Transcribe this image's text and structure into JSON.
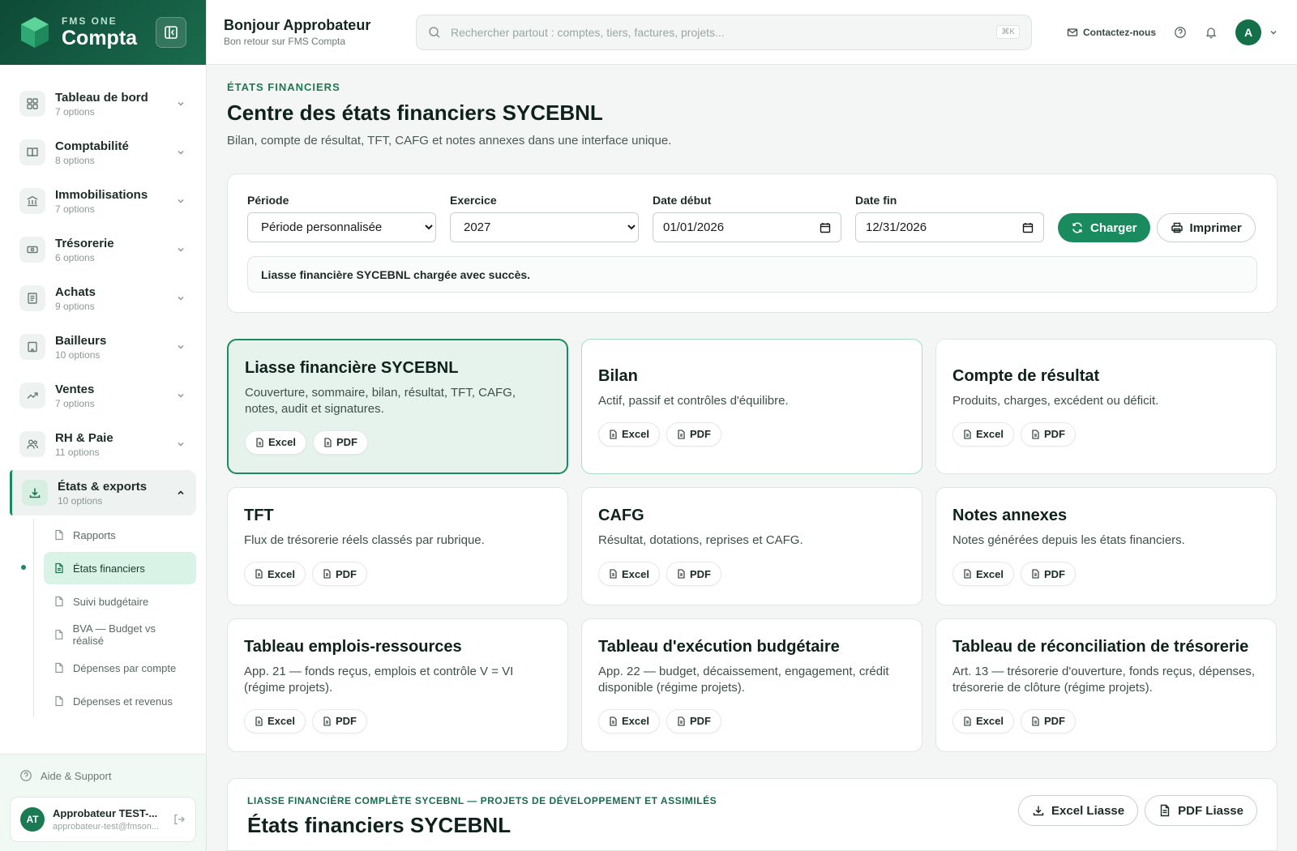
{
  "brand": {
    "small": "FMS ONE",
    "big": "Compta"
  },
  "header": {
    "greeting": "Bonjour Approbateur",
    "subtitle": "Bon retour sur FMS Compta",
    "search_placeholder": "Rechercher partout : comptes, tiers, factures, projets...",
    "search_shortcut": "⌘K",
    "contact_label": "Contactez-nous",
    "avatar_initial": "A"
  },
  "sidebar": {
    "items": [
      {
        "label": "Tableau de bord",
        "sub": "7 options",
        "icon": "dashboard-icon"
      },
      {
        "label": "Comptabilité",
        "sub": "8 options",
        "icon": "book-icon"
      },
      {
        "label": "Immobilisations",
        "sub": "7 options",
        "icon": "bank-icon"
      },
      {
        "label": "Trésorerie",
        "sub": "6 options",
        "icon": "cash-icon"
      },
      {
        "label": "Achats",
        "sub": "9 options",
        "icon": "receipt-icon"
      },
      {
        "label": "Bailleurs",
        "sub": "10 options",
        "icon": "building-icon"
      },
      {
        "label": "Ventes",
        "sub": "7 options",
        "icon": "trend-icon"
      },
      {
        "label": "RH & Paie",
        "sub": "11 options",
        "icon": "users-icon"
      },
      {
        "label": "États & exports",
        "sub": "10 options",
        "icon": "download-icon"
      }
    ],
    "subitems": [
      {
        "label": "Rapports"
      },
      {
        "label": "États financiers"
      },
      {
        "label": "Suivi budgétaire"
      },
      {
        "label": "BVA — Budget vs réalisé"
      },
      {
        "label": "Dépenses par compte"
      },
      {
        "label": "Dépenses et revenus"
      }
    ],
    "help_label": "Aide & Support",
    "user": {
      "initials": "AT",
      "name": "Approbateur TEST-...",
      "email": "approbateur-test@fmson..."
    }
  },
  "page": {
    "eyebrow": "ÉTATS FINANCIERS",
    "title": "Centre des états financiers SYCEBNL",
    "subtitle": "Bilan, compte de résultat, TFT, CAFG et notes annexes dans une interface unique."
  },
  "filters": {
    "periode_label": "Période",
    "periode_value": "Période personnalisée",
    "exercice_label": "Exercice",
    "exercice_value": "2027",
    "date_debut_label": "Date début",
    "date_debut_value": "01/01/2026",
    "date_fin_label": "Date fin",
    "date_fin_value": "12/31/2026",
    "charger_label": "Charger",
    "imprimer_label": "Imprimer",
    "alert": "Liasse financière SYCEBNL chargée avec succès."
  },
  "reports": [
    {
      "title": "Liasse financière SYCEBNL",
      "desc": "Couverture, sommaire, bilan, résultat, TFT, CAFG, notes, audit et signatures.",
      "excel": "Excel",
      "pdf": "PDF"
    },
    {
      "title": "Bilan",
      "desc": "Actif, passif et contrôles d'équilibre.",
      "excel": "Excel",
      "pdf": "PDF"
    },
    {
      "title": "Compte de résultat",
      "desc": "Produits, charges, excédent ou déficit.",
      "excel": "Excel",
      "pdf": "PDF"
    },
    {
      "title": "TFT",
      "desc": "Flux de trésorerie réels classés par rubrique.",
      "excel": "Excel",
      "pdf": "PDF"
    },
    {
      "title": "CAFG",
      "desc": "Résultat, dotations, reprises et CAFG.",
      "excel": "Excel",
      "pdf": "PDF"
    },
    {
      "title": "Notes annexes",
      "desc": "Notes générées depuis les états financiers.",
      "excel": "Excel",
      "pdf": "PDF"
    },
    {
      "title": "Tableau emplois-ressources",
      "desc": "App. 21 — fonds reçus, emplois et contrôle V = VI (régime projets).",
      "excel": "Excel",
      "pdf": "PDF"
    },
    {
      "title": "Tableau d'exécution budgétaire",
      "desc": "App. 22 — budget, décaissement, engagement, crédit disponible (régime projets).",
      "excel": "Excel",
      "pdf": "PDF"
    },
    {
      "title": "Tableau de réconciliation de trésorerie",
      "desc": "Art. 13 — trésorerie d'ouverture, fonds reçus, dépenses, trésorerie de clôture (régime projets).",
      "excel": "Excel",
      "pdf": "PDF"
    }
  ],
  "liasse": {
    "eyebrow": "LIASSE FINANCIÈRE COMPLÈTE SYCEBNL — PROJETS DE DÉVELOPPEMENT ET ASSIMILÉS",
    "title": "États financiers SYCEBNL",
    "excel_label": "Excel Liasse",
    "pdf_label": "PDF Liasse"
  },
  "colors": {
    "accent": "#1a8a5f",
    "brand_dark": "#0e4a36",
    "highlight_bg": "#e6f3ed"
  }
}
